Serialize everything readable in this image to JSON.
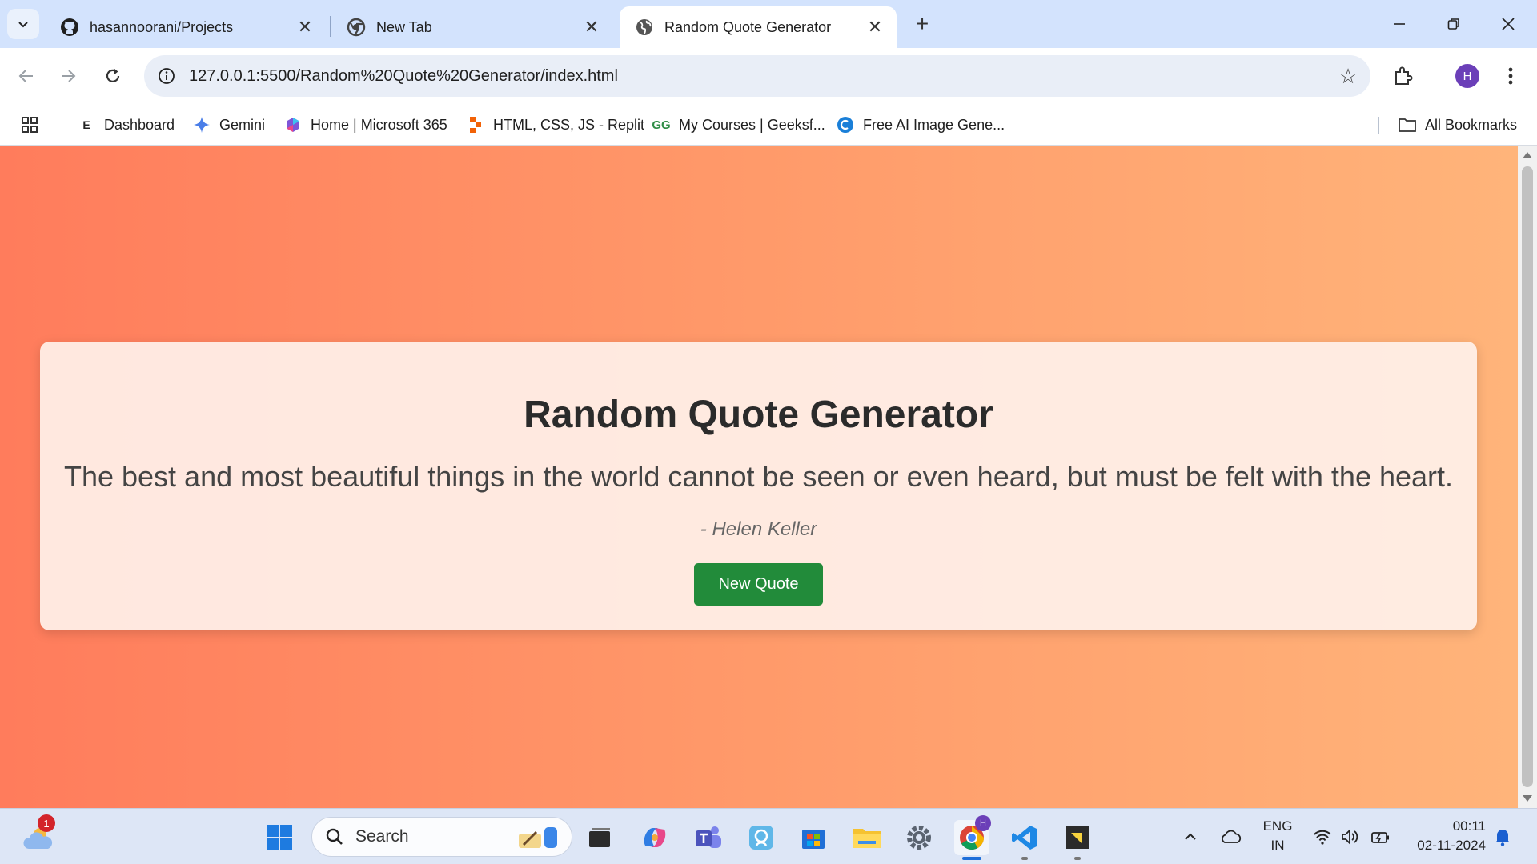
{
  "tabs": [
    {
      "title": "hasannoorani/Projects",
      "active": false
    },
    {
      "title": "New Tab",
      "active": false
    },
    {
      "title": "Random Quote Generator",
      "active": true
    }
  ],
  "address_bar": {
    "url": "127.0.0.1:5500/Random%20Quote%20Generator/index.html"
  },
  "profile": {
    "initial": "H"
  },
  "bookmarks": [
    {
      "label": "Dashboard"
    },
    {
      "label": "Gemini"
    },
    {
      "label": "Home | Microsoft 365"
    },
    {
      "label": "HTML, CSS, JS - Replit"
    },
    {
      "label": "My Courses | Geeksf..."
    },
    {
      "label": "Free AI Image Gene..."
    },
    {
      "label": "All Bookmarks"
    }
  ],
  "page": {
    "title": "Random Quote Generator",
    "quote": "The best and most beautiful things in the world cannot be seen or even heard, but must be felt with the heart.",
    "author": "- Helen Keller",
    "button_label": "New Quote",
    "button_color": "#228b3a"
  },
  "taskbar": {
    "search_label": "Search",
    "weather_badge": "1",
    "chrome_profile_badge": "H",
    "language": "ENG",
    "region": "IN",
    "time": "00:11",
    "date": "02-11-2024"
  }
}
